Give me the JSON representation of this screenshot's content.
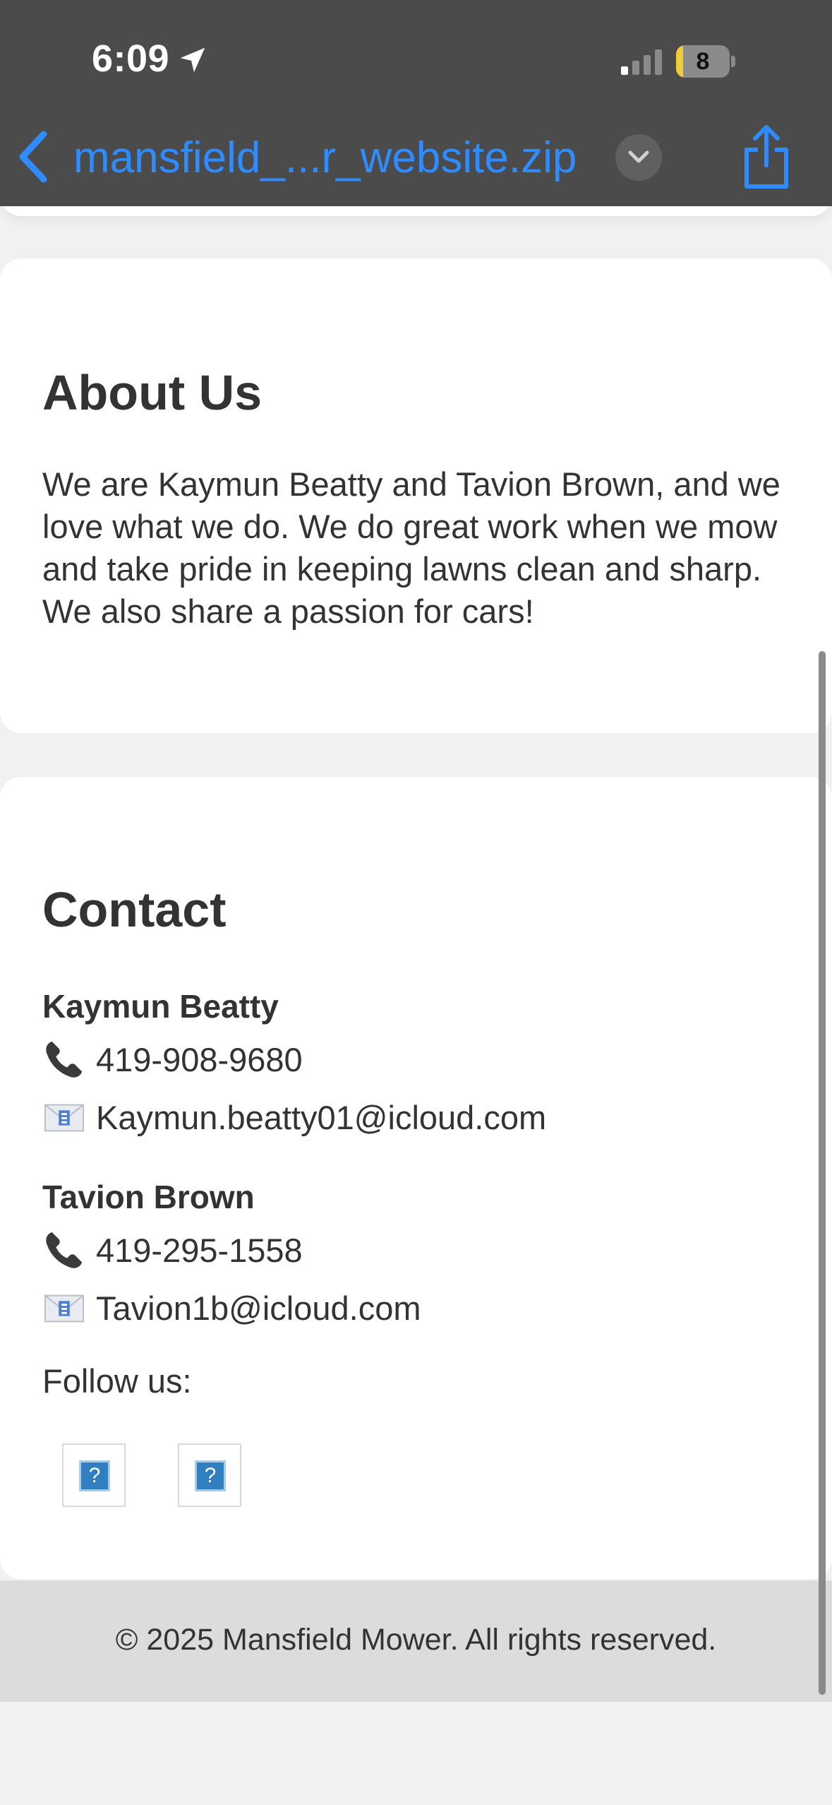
{
  "status_bar": {
    "time": "6:09",
    "battery_level": "8",
    "battery_fraction": 0.08,
    "signal_bars_active": 1,
    "icons": [
      "location-arrow-icon",
      "cellular-signal-icon",
      "battery-icon"
    ]
  },
  "nav_bar": {
    "title": "mansfield_...r_website.zip",
    "icons": [
      "chevron-left-icon",
      "chevron-down-icon",
      "share-icon"
    ],
    "accent_color": "#2f8cff"
  },
  "about": {
    "heading": "About Us",
    "text": "We are Kaymun Beatty and Tavion Brown, and we love what we do. We do great work when we mow and take pride in keeping lawns clean and sharp. We also share a passion for cars!"
  },
  "contact": {
    "heading": "Contact",
    "people": [
      {
        "name": "Kaymun Beatty",
        "phone": "419-908-9680",
        "email": "Kaymun.beatty01@icloud.com"
      },
      {
        "name": "Tavion Brown",
        "phone": "419-295-1558",
        "email": "Tavion1b@icloud.com"
      }
    ],
    "follow_label": "Follow us:",
    "social_placeholder": "?",
    "icons": [
      "phone-icon",
      "envelope-icon",
      "broken-image-icon"
    ]
  },
  "footer": {
    "text": "© 2025 Mansfield Mower. All rights reserved."
  }
}
